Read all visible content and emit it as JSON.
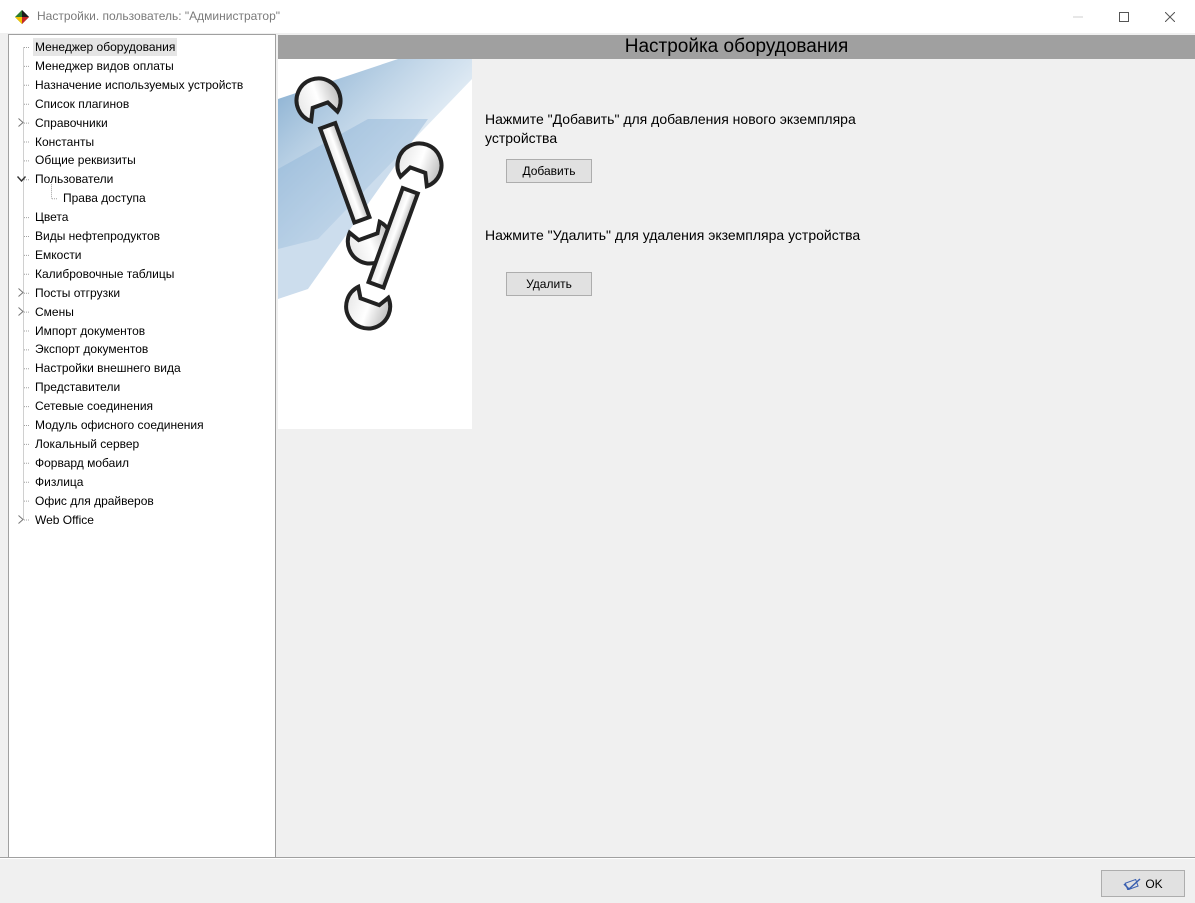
{
  "window": {
    "title": "Настройки. пользователь: \"Администратор\"",
    "app_icon": "diamond-app-icon"
  },
  "tree": {
    "items": [
      {
        "label": "Менеджер оборудования",
        "selected": true,
        "expandable": false,
        "expanded": false,
        "level": 0
      },
      {
        "label": "Менеджер видов оплаты",
        "selected": false,
        "expandable": false,
        "expanded": false,
        "level": 0
      },
      {
        "label": "Назначение используемых устройств",
        "selected": false,
        "expandable": false,
        "expanded": false,
        "level": 0
      },
      {
        "label": "Список плагинов",
        "selected": false,
        "expandable": false,
        "expanded": false,
        "level": 0
      },
      {
        "label": "Справочники",
        "selected": false,
        "expandable": true,
        "expanded": false,
        "level": 0
      },
      {
        "label": "Константы",
        "selected": false,
        "expandable": false,
        "expanded": false,
        "level": 0
      },
      {
        "label": "Общие реквизиты",
        "selected": false,
        "expandable": false,
        "expanded": false,
        "level": 0
      },
      {
        "label": "Пользователи",
        "selected": false,
        "expandable": true,
        "expanded": true,
        "level": 0
      },
      {
        "label": "Права доступа",
        "selected": false,
        "expandable": false,
        "expanded": false,
        "level": 1
      },
      {
        "label": "Цвета",
        "selected": false,
        "expandable": false,
        "expanded": false,
        "level": 0
      },
      {
        "label": "Виды нефтепродуктов",
        "selected": false,
        "expandable": false,
        "expanded": false,
        "level": 0
      },
      {
        "label": "Емкости",
        "selected": false,
        "expandable": false,
        "expanded": false,
        "level": 0
      },
      {
        "label": "Калибровочные таблицы",
        "selected": false,
        "expandable": false,
        "expanded": false,
        "level": 0
      },
      {
        "label": "Посты отгрузки",
        "selected": false,
        "expandable": true,
        "expanded": false,
        "level": 0
      },
      {
        "label": "Смены",
        "selected": false,
        "expandable": true,
        "expanded": false,
        "level": 0
      },
      {
        "label": "Импорт документов",
        "selected": false,
        "expandable": false,
        "expanded": false,
        "level": 0
      },
      {
        "label": "Экспорт документов",
        "selected": false,
        "expandable": false,
        "expanded": false,
        "level": 0
      },
      {
        "label": "Настройки внешнего вида",
        "selected": false,
        "expandable": false,
        "expanded": false,
        "level": 0
      },
      {
        "label": "Представители",
        "selected": false,
        "expandable": false,
        "expanded": false,
        "level": 0
      },
      {
        "label": "Сетевые соединения",
        "selected": false,
        "expandable": false,
        "expanded": false,
        "level": 0
      },
      {
        "label": "Модуль офисного соединения",
        "selected": false,
        "expandable": false,
        "expanded": false,
        "level": 0
      },
      {
        "label": "Локальный сервер",
        "selected": false,
        "expandable": false,
        "expanded": false,
        "level": 0
      },
      {
        "label": "Форвард мобаил",
        "selected": false,
        "expandable": false,
        "expanded": false,
        "level": 0
      },
      {
        "label": "Физлица",
        "selected": false,
        "expandable": false,
        "expanded": false,
        "level": 0
      },
      {
        "label": "Офис для драйверов",
        "selected": false,
        "expandable": false,
        "expanded": false,
        "level": 0
      },
      {
        "label": "Web Office",
        "selected": false,
        "expandable": true,
        "expanded": false,
        "level": 0
      }
    ]
  },
  "content": {
    "header": "Настройка оборудования",
    "illustration_icon": "wrenches-icon",
    "add_hint": "Нажмите \"Добавить\" для добавления нового экземпляра устройства",
    "add_button": "Добавить",
    "delete_hint": "Нажмите \"Удалить\" для удаления экземпляра устройства",
    "delete_button": "Удалить"
  },
  "footer": {
    "ok_button": "OK",
    "ok_icon": "checkmark-icon"
  },
  "colors": {
    "header_bar": "#a0a0a0",
    "selection": "#e5e5e5",
    "background": "#f0f0f0"
  }
}
